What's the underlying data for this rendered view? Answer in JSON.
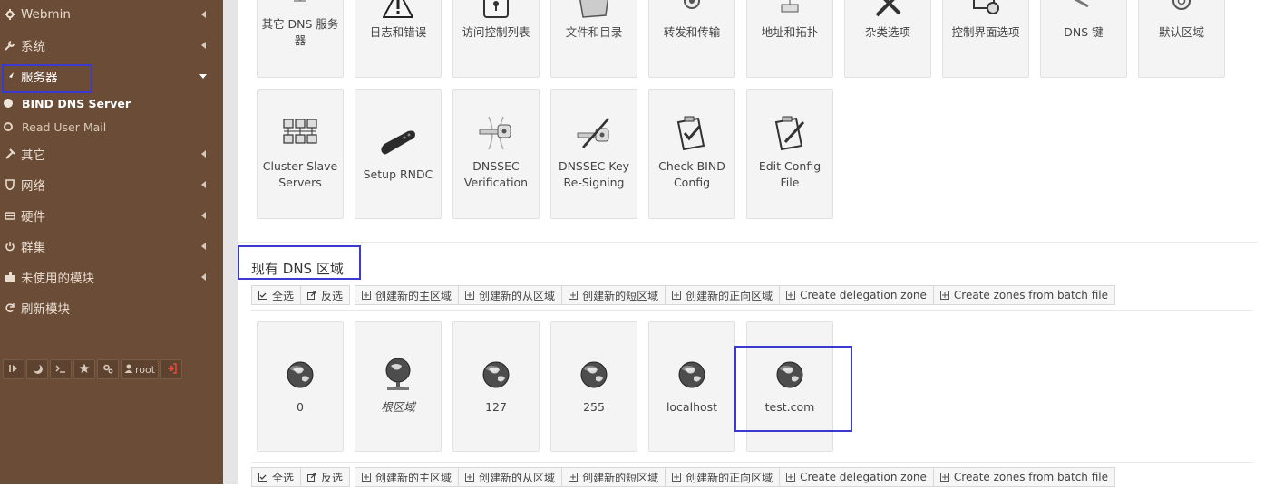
{
  "sidebar": {
    "items": [
      {
        "label": "Webmin",
        "icon": "gear-icon"
      },
      {
        "label": "系统",
        "icon": "wrench-icon"
      },
      {
        "label": "服务器",
        "icon": "rocket-icon"
      },
      {
        "label": "其它",
        "icon": "tools-icon"
      },
      {
        "label": "网络",
        "icon": "shield-icon"
      },
      {
        "label": "硬件",
        "icon": "drive-icon"
      },
      {
        "label": "群集",
        "icon": "power-icon"
      },
      {
        "label": "未使用的模块",
        "icon": "puzzle-icon"
      },
      {
        "label": "刷新模块",
        "icon": "refresh-icon"
      }
    ],
    "sub_items": [
      {
        "label": "BIND DNS Server",
        "current": true
      },
      {
        "label": "Read User Mail",
        "current": false
      }
    ],
    "toolbar": {
      "user": "root"
    }
  },
  "top_tiles": [
    {
      "label": "其它 DNS 服务器",
      "icon": "computer-icon"
    },
    {
      "label": "日志和错误",
      "icon": "warning-icon"
    },
    {
      "label": "访问控制列表",
      "icon": "lock-icon"
    },
    {
      "label": "文件和目录",
      "icon": "folder-icon"
    },
    {
      "label": "转发和传输",
      "icon": "cogs-icon"
    },
    {
      "label": "地址和拓扑",
      "icon": "network-icon"
    },
    {
      "label": "杂类选项",
      "icon": "tools-icon"
    },
    {
      "label": "控制界面选项",
      "icon": "computer-settings-icon"
    },
    {
      "label": "DNS 键",
      "icon": "key-icon"
    },
    {
      "label": "默认区域",
      "icon": "gear-icon"
    }
  ],
  "tiles_row2": [
    {
      "label": "Cluster Slave Servers",
      "icon": "cluster-servers-icon"
    },
    {
      "label": "Setup RNDC",
      "icon": "remote-control-icon"
    },
    {
      "label": "DNSSEC Verification",
      "icon": "key-verify-icon"
    },
    {
      "label": "DNSSEC Key Re-Signing",
      "icon": "key-pen-icon"
    },
    {
      "label": "Check BIND Config",
      "icon": "clipboard-check-icon"
    },
    {
      "label": "Edit Config File",
      "icon": "clipboard-edit-icon"
    }
  ],
  "zones_title": "现有 DNS 区域",
  "button_bar": [
    {
      "label": "全选",
      "icon": "checkbox-icon"
    },
    {
      "label": "反选",
      "icon": "share-icon"
    },
    {
      "label": "创建新的主区域",
      "icon": "plus-square-icon"
    },
    {
      "label": "创建新的从区域",
      "icon": "plus-square-icon"
    },
    {
      "label": "创建新的短区域",
      "icon": "plus-square-icon"
    },
    {
      "label": "创建新的正向区域",
      "icon": "plus-square-icon"
    },
    {
      "label": "Create delegation zone",
      "icon": "plus-square-icon"
    },
    {
      "label": "Create zones from batch file",
      "icon": "plus-square-icon"
    }
  ],
  "zones": [
    {
      "label": "0",
      "icon": "globe-icon"
    },
    {
      "label": "根区域",
      "icon": "globe-server-icon"
    },
    {
      "label": "127",
      "icon": "globe-icon"
    },
    {
      "label": "255",
      "icon": "globe-icon"
    },
    {
      "label": "localhost",
      "icon": "globe-icon"
    },
    {
      "label": "test.com",
      "icon": "globe-icon"
    }
  ],
  "colors": {
    "sidebar_bg": "#6b4c36",
    "highlight": "#3a3ad0",
    "tile_bg": "#f4f4f4"
  }
}
